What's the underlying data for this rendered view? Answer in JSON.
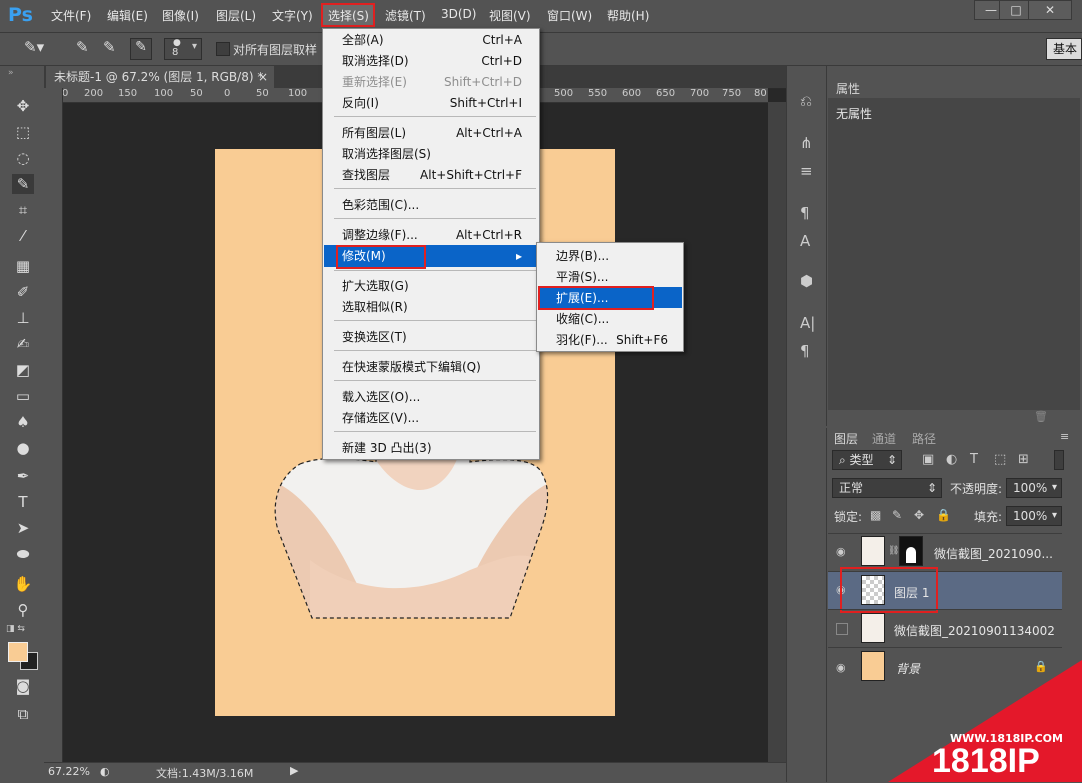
{
  "app": {
    "logo": "Ps"
  },
  "menubar": {
    "items": [
      "文件(F)",
      "编辑(E)",
      "图像(I)",
      "图层(L)",
      "文字(Y)",
      "选择(S)",
      "滤镜(T)",
      "3D(D)",
      "视图(V)",
      "窗口(W)",
      "帮助(H)"
    ],
    "active": "选择(S)"
  },
  "window_controls": {
    "minimize": "—",
    "maximize": "□",
    "close": "✕"
  },
  "options_bar": {
    "brush_size": "8",
    "sample_all_layers": "对所有图层取样",
    "workspace": "基本"
  },
  "document": {
    "tab_title": "未标题-1 @ 67.2% (图层 1, RGB/8) *",
    "close": "×",
    "canvas_color": "#f9cc94"
  },
  "ruler": {
    "left_ticks": [
      "0",
      "200",
      "150",
      "100",
      "50",
      "0",
      "50",
      "100"
    ],
    "right_ticks": [
      "500",
      "550",
      "600",
      "650",
      "700",
      "750",
      "80"
    ]
  },
  "status": {
    "zoom": "67.22%",
    "doc_info": "文档:1.43M/3.16M"
  },
  "select_menu": {
    "groups": [
      [
        {
          "label": "全部(A)",
          "shortcut": "Ctrl+A"
        },
        {
          "label": "取消选择(D)",
          "shortcut": "Ctrl+D"
        },
        {
          "label": "重新选择(E)",
          "shortcut": "Shift+Ctrl+D",
          "disabled": true
        },
        {
          "label": "反向(I)",
          "shortcut": "Shift+Ctrl+I"
        }
      ],
      [
        {
          "label": "所有图层(L)",
          "shortcut": "Alt+Ctrl+A"
        },
        {
          "label": "取消选择图层(S)",
          "shortcut": ""
        },
        {
          "label": "查找图层",
          "shortcut": "Alt+Shift+Ctrl+F"
        }
      ],
      [
        {
          "label": "色彩范围(C)...",
          "shortcut": ""
        }
      ],
      [
        {
          "label": "调整边缘(F)...",
          "shortcut": "Alt+Ctrl+R"
        },
        {
          "label": "修改(M)",
          "shortcut": "▸"
        }
      ],
      [
        {
          "label": "扩大选取(G)",
          "shortcut": ""
        },
        {
          "label": "选取相似(R)",
          "shortcut": ""
        }
      ],
      [
        {
          "label": "变换选区(T)",
          "shortcut": ""
        }
      ],
      [
        {
          "label": "在快速蒙版模式下编辑(Q)",
          "shortcut": ""
        }
      ],
      [
        {
          "label": "载入选区(O)...",
          "shortcut": ""
        },
        {
          "label": "存储选区(V)...",
          "shortcut": ""
        }
      ],
      [
        {
          "label": "新建 3D 凸出(3)",
          "shortcut": ""
        }
      ]
    ]
  },
  "modify_submenu": {
    "items": [
      {
        "label": "边界(B)...",
        "shortcut": ""
      },
      {
        "label": "平滑(S)...",
        "shortcut": ""
      },
      {
        "label": "扩展(E)...",
        "shortcut": ""
      },
      {
        "label": "收缩(C)...",
        "shortcut": ""
      },
      {
        "label": "羽化(F)...",
        "shortcut": "Shift+F6"
      }
    ]
  },
  "properties_panel": {
    "tab": "属性",
    "message": "无属性"
  },
  "layers_panel": {
    "tabs": [
      "图层",
      "通道",
      "路径"
    ],
    "filter": "类型",
    "blend_mode": "正常",
    "opacity_label": "不透明度:",
    "opacity": "100%",
    "lock_label": "锁定:",
    "fill_label": "填充:",
    "fill": "100%",
    "layers": [
      {
        "name": "微信截图_2021090...",
        "visible": true
      },
      {
        "name": "图层 1",
        "visible": true
      },
      {
        "name": "微信截图_20210901134002",
        "visible": false
      },
      {
        "name": "背景",
        "visible": true
      }
    ]
  },
  "watermark": {
    "url": "WWW.1818IP.COM",
    "brand": "1818IP"
  }
}
